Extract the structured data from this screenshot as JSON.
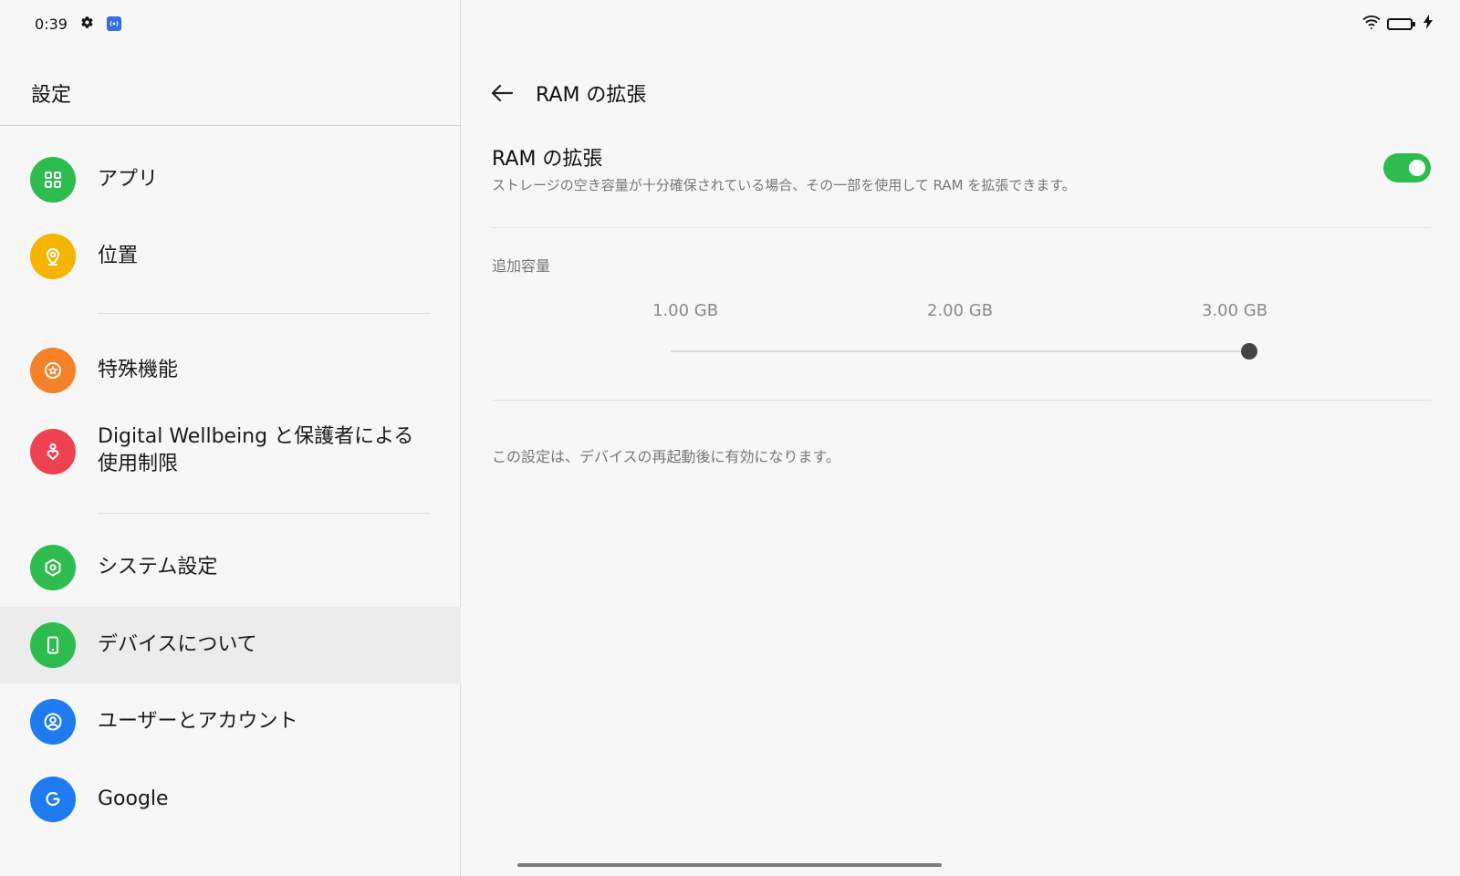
{
  "status": {
    "time": "0:39",
    "left_icons": [
      "gear-icon",
      "cast-icon"
    ],
    "right_icons": [
      "wifi-icon",
      "battery-icon",
      "charging-icon"
    ]
  },
  "sidebar": {
    "title": "設定",
    "items": [
      {
        "label": "アプリ",
        "icon": "apps-grid-icon",
        "color": "#2ebc4f"
      },
      {
        "label": "位置",
        "icon": "location-pin-icon",
        "color": "#f5b400"
      },
      {
        "label": "特殊機能",
        "icon": "star-circle-icon",
        "color": "#f5822a"
      },
      {
        "label": "Digital Wellbeing と保護者による使用制限",
        "icon": "heart-person-icon",
        "color": "#ee4152"
      },
      {
        "label": "システム設定",
        "icon": "hexagon-gear-icon",
        "color": "#2ebc4f"
      },
      {
        "label": "デバイスについて",
        "icon": "phone-icon",
        "color": "#2ebc4f",
        "selected": true
      },
      {
        "label": "ユーザーとアカウント",
        "icon": "user-circle-icon",
        "color": "#1e7cf0"
      },
      {
        "label": "Google",
        "icon": "google-g-icon",
        "color": "#1e7cf0"
      }
    ]
  },
  "main": {
    "page_title": "RAM の拡張",
    "setting": {
      "title": "RAM の拡張",
      "description": "ストレージの空き容量が十分確保されている場合、その一部を使用して RAM を拡張できます。",
      "enabled": true
    },
    "capacity": {
      "label": "追加容量",
      "options": [
        "1.00 GB",
        "2.00 GB",
        "3.00 GB"
      ],
      "selected": "3.00 GB"
    },
    "note": "この設定は、デバイスの再起動後に有効になります。"
  },
  "colors": {
    "accent_green": "#2ebc4f",
    "selected_row": "#ececec"
  }
}
